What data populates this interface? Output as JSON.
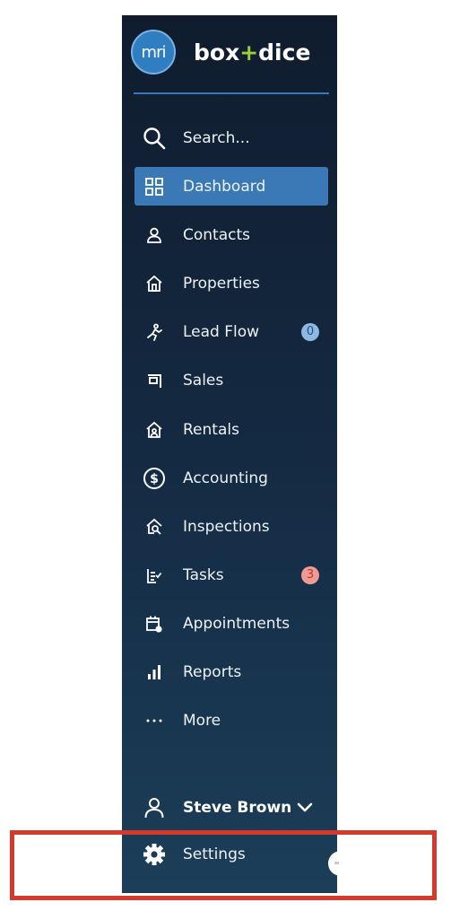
{
  "brand": {
    "logo_text": "mri",
    "name_before": "box",
    "name_plus": "+",
    "name_after": "dice",
    "accent": "#9ccf3b"
  },
  "colors": {
    "active": "#3b79b6",
    "divider": "#3577bb",
    "highlight": "#d5392b"
  },
  "search": {
    "label": "Search..."
  },
  "nav": [
    {
      "label": "Dashboard",
      "icon": "grid-icon",
      "active": true
    },
    {
      "label": "Contacts",
      "icon": "person-icon"
    },
    {
      "label": "Properties",
      "icon": "house-icon"
    },
    {
      "label": "Lead Flow",
      "icon": "runner-icon",
      "badge": "0"
    },
    {
      "label": "Sales",
      "icon": "sign-icon"
    },
    {
      "label": "Rentals",
      "icon": "house-people-icon"
    },
    {
      "label": "Accounting",
      "icon": "dollar-circle-icon"
    },
    {
      "label": "Inspections",
      "icon": "house-search-icon"
    },
    {
      "label": "Tasks",
      "icon": "checklist-icon",
      "badge": "3"
    },
    {
      "label": "Appointments",
      "icon": "calendar-icon"
    },
    {
      "label": "Reports",
      "icon": "bar-chart-icon"
    },
    {
      "label": "More",
      "icon": "ellipsis-icon"
    }
  ],
  "user": {
    "name": "Steve Brown"
  },
  "settings": {
    "label": "Settings"
  }
}
